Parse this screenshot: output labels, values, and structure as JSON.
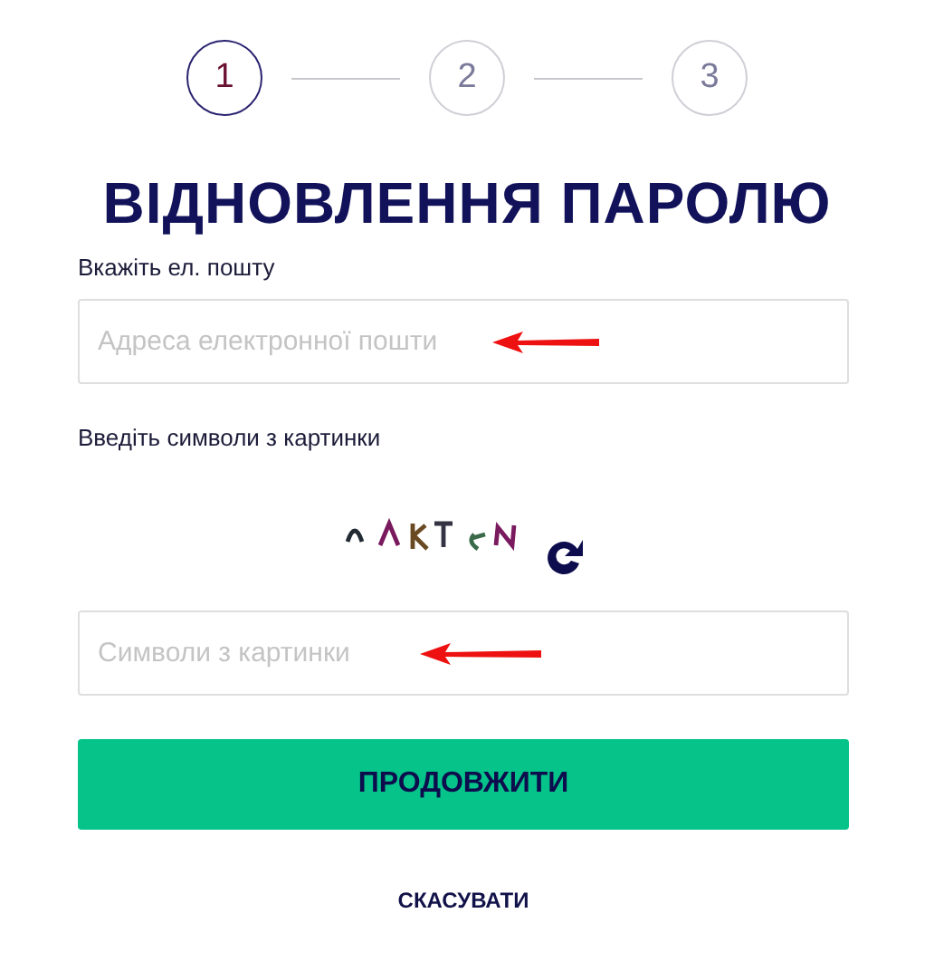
{
  "steps": [
    {
      "label": "1",
      "selected": true
    },
    {
      "label": "2",
      "selected": false
    },
    {
      "label": "3",
      "selected": false
    }
  ],
  "title": "ВІДНОВЛЕННЯ ПАРОЛЮ",
  "email": {
    "label": "Вкажіть ел. пошту",
    "placeholder": "Адреса електронної пошти"
  },
  "captcha": {
    "label": "Введіть символи з картинки",
    "placeholder": "Символи з картинки"
  },
  "continue_button": "ПРОДОВЖИТИ",
  "cancel_link": "СКАСУВАТИ"
}
